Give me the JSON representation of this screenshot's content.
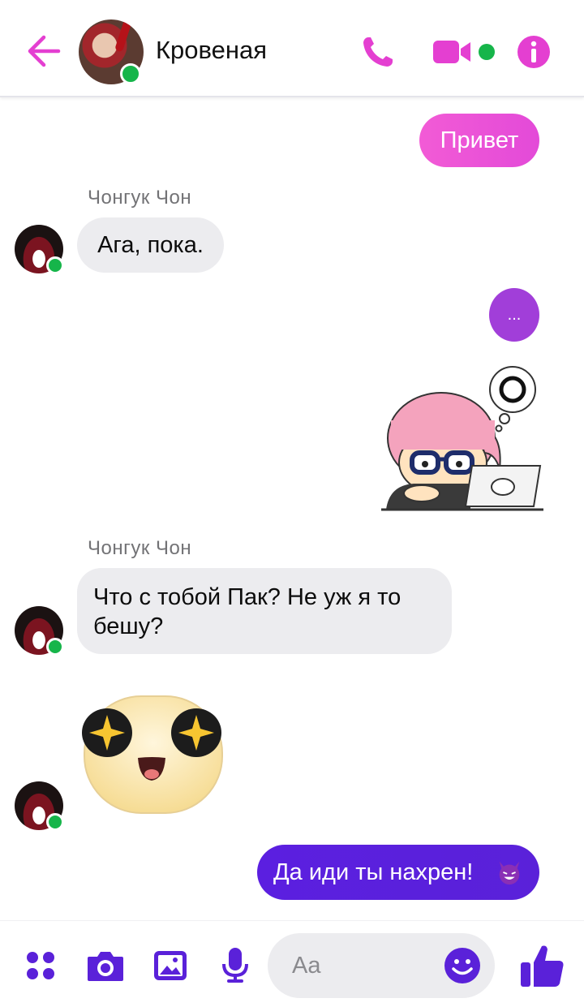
{
  "header": {
    "contact_name": "Кровеная",
    "icons": [
      "back-arrow-icon",
      "phone-icon",
      "video-camera-icon",
      "info-icon"
    ]
  },
  "messages": {
    "m1_text": "Привет",
    "sender1": "Чонгук Чон",
    "m2_text": "Ага, пока.",
    "m3_text": "...",
    "sender2": "Чонгук Чон",
    "m4_line1": "Что с тобой Пак? Не уж я  то",
    "m4_line2": "бешу?",
    "m5_text": "Да иди ты нахрен!"
  },
  "composer": {
    "placeholder": "Aa"
  },
  "colors": {
    "accent": "#e43fd1",
    "accent_purple": "#5a21d9",
    "online": "#16b54a"
  }
}
